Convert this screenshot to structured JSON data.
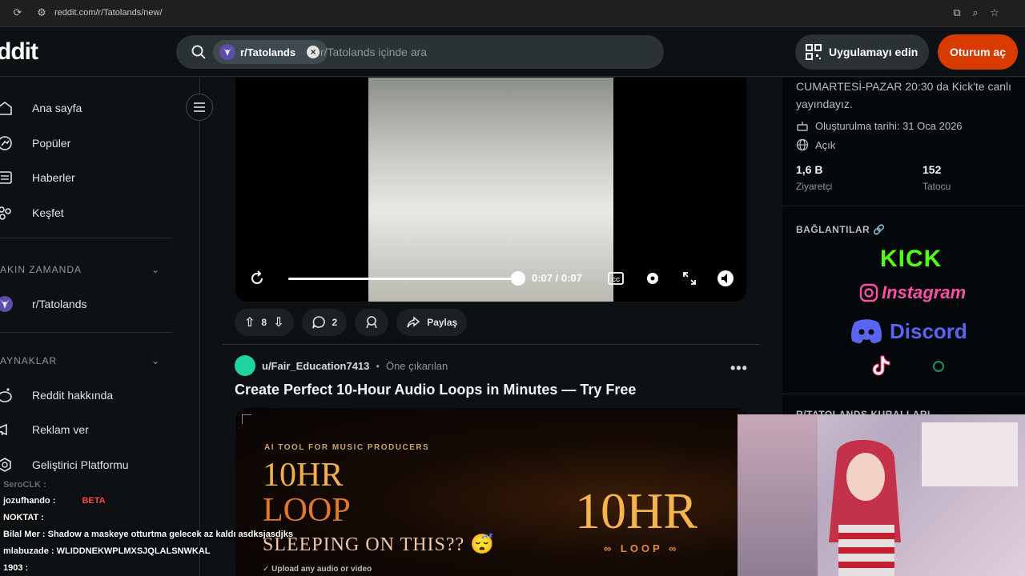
{
  "browser": {
    "url": "reddit.com/r/Tatolands/new/"
  },
  "header": {
    "logo": "ddit",
    "search_chip": "r/Tatolands",
    "search_placeholder": "r/Tatolands içinde ara",
    "app_button": "Uygulamayı edin",
    "login_button": "Oturum aç"
  },
  "sidebar": {
    "items": [
      {
        "label": "Ana sayfa",
        "icon": "home-icon"
      },
      {
        "label": "Popüler",
        "icon": "popular-icon"
      },
      {
        "label": "Haberler",
        "icon": "news-icon"
      },
      {
        "label": "Keşfet",
        "icon": "explore-icon"
      }
    ],
    "recent_heading": "AKIN ZAMANDA",
    "recent_items": [
      {
        "label": "r/Tatolands",
        "icon": "fox-icon"
      }
    ],
    "resources_heading": "AYNAKLAR",
    "resources_items": [
      {
        "label": "Reddit hakkında",
        "icon": "reddit-icon"
      },
      {
        "label": "Reklam ver",
        "icon": "megaphone-icon"
      },
      {
        "label": "Geliştirici Platformu",
        "icon": "developer-icon"
      }
    ]
  },
  "video": {
    "time": "0:07 / 0:07",
    "progress": 1.0
  },
  "post_actions": {
    "votes": "8",
    "comments": "2",
    "share": "Paylaş"
  },
  "post2": {
    "author": "u/Fair_Education7413",
    "separator": "•",
    "promoted": "Öne çıkarılan",
    "more": "•••",
    "title": "Create Perfect 10-Hour Audio Loops in Minutes — Try Free",
    "ad_tag": "AI TOOL FOR MUSIC PRODUCERS",
    "ad_line1": "10HR",
    "ad_line2": "LOOP",
    "ad_sleeping": "SLEEPING ON THIS?? 😴",
    "ad_right": "10HR",
    "ad_loop": "∞ LOOP ∞",
    "ad_upload": "✓ Upload any audio or video"
  },
  "right_panel": {
    "schedule": "CUMARTESİ-PAZAR 20:30 da Kick'te canlı yayındayız.",
    "created": "Oluşturulma tarihi: 31 Oca 2026",
    "visibility": "Açık",
    "stats": [
      {
        "value": "1,6 B",
        "label": "Ziyaretçi"
      },
      {
        "value": "152",
        "label": "Tatocu"
      }
    ],
    "links_heading": "BAĞLANTILAR 🔗",
    "kick": "KICK",
    "instagram": "Instagram",
    "discord": "Discord",
    "rules_heading": "R/TATOLANDS KURALLARI"
  },
  "chat": [
    {
      "text": "SeroCLK :"
    },
    {
      "text": "jozufhando :",
      "badge": "BETA"
    },
    {
      "text": "NOKTAT :"
    },
    {
      "text": "Bilal Mer : Shadow a maskeye otturtma gelecek az kaldı asdksjasdjks"
    },
    {
      "text": "mlabuzade : WLIDDNEKWPLMXSJQLALSNWKAL"
    },
    {
      "text": "1903 :"
    }
  ],
  "colors": {
    "accent": "#d93a00",
    "kick": "#53fc18",
    "discord": "#5865f2",
    "instagram": "#ff4fa3"
  }
}
